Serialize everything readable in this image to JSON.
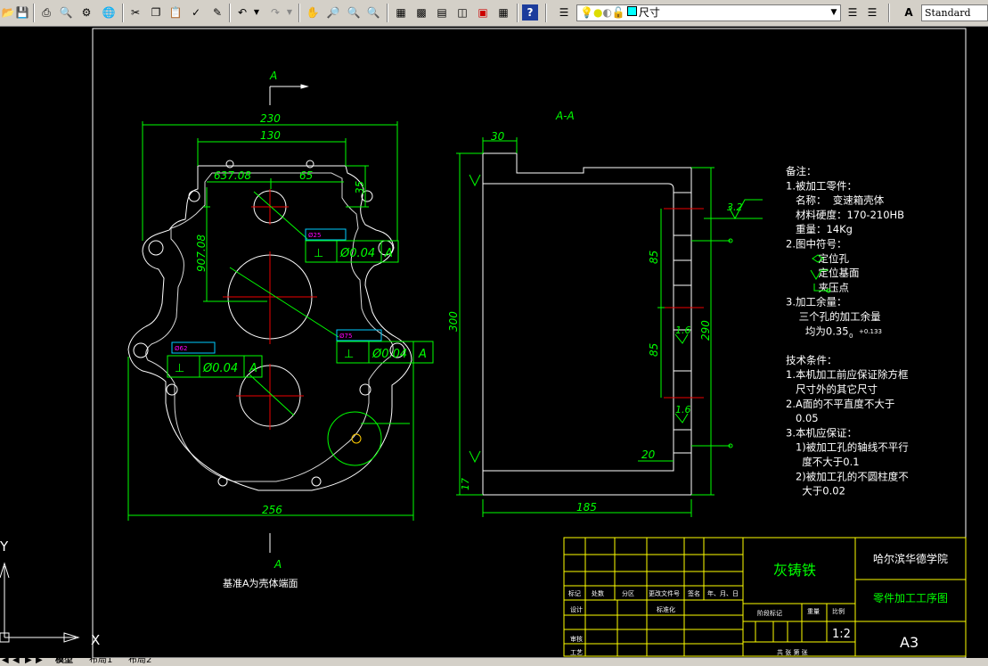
{
  "toolbar": {
    "buttons": [
      "save",
      "print",
      "preview",
      "publish",
      "plot",
      "cut",
      "copy",
      "paste",
      "match-properties",
      "brush",
      "undo",
      "redo",
      "pan",
      "zoom-realtime",
      "zoom-window",
      "zoom-previous",
      "properties",
      "design-center",
      "tool-palettes",
      "sheet-set",
      "markup",
      "calculator",
      "help"
    ],
    "layer_value": "尺寸",
    "style_value": "Standard"
  },
  "drawing": {
    "view_label_top": "A",
    "view_label_bottom": "A",
    "section_title": "A-A",
    "datum_note": "基准A为壳体端面",
    "front_dims": {
      "d230": "230",
      "d130": "130",
      "d637": "637.08",
      "d65": "65",
      "d35": "35",
      "d907": "907.08",
      "d256": "256"
    },
    "front_tolerances": [
      {
        "dia": "Ø25",
        "symbol": "Ø0.04",
        "datum": "A"
      },
      {
        "dia": "Ø75",
        "symbol": "Ø0.04",
        "datum": "A"
      },
      {
        "dia": "Ø62",
        "symbol": "Ø0.04",
        "datum": "A"
      }
    ],
    "section_dims": {
      "d30": "30",
      "d300": "300",
      "d85a": "85",
      "d85b": "85",
      "d290": "290",
      "d185": "185",
      "d20": "20",
      "d17": "17",
      "r32": "3.2",
      "r16a": "1.6",
      "r16b": "1.6"
    },
    "notes": [
      "备注：",
      "1.被加工零件：",
      "   名称：  变速箱壳体",
      "   材料硬度：170-210HB",
      "   重量：14Kg",
      "2.图中符号：",
      "          定位孔",
      "          定位基面",
      "          夹压点",
      "3.加工余量：",
      "    三个孔的加工余量",
      "      均为0.35",
      "",
      "技术条件：",
      "1.本机加工前应保证除方框",
      "   尺寸外的其它尺寸",
      "2.A面的不平直度不大于",
      "   0.05",
      "3.本机应保证：",
      "   1)被加工孔的轴线不平行",
      "     度不大于0.1",
      "   2)被加工孔的不圆柱度不",
      "     大于0.02"
    ],
    "title_block": {
      "material": "灰铸铁",
      "school": "哈尔滨华德学院",
      "drawing_name": "零件加工工序图",
      "sheet": "A3",
      "scale": "1:2",
      "headers": [
        "标记",
        "处数",
        "分区",
        "更改文件号",
        "签名",
        "年、月、日"
      ],
      "row_design": "设计",
      "row_std": "标准化",
      "row_review": "审核",
      "row_process": "工艺",
      "stage_label": "阶段标记",
      "weight_label": "重量",
      "scale_label": "比例",
      "sheets_label": "共    张    第    张"
    },
    "ucs_x": "X",
    "ucs_y": "Y"
  },
  "tabs": [
    "模型",
    "布局1",
    "布局2"
  ]
}
